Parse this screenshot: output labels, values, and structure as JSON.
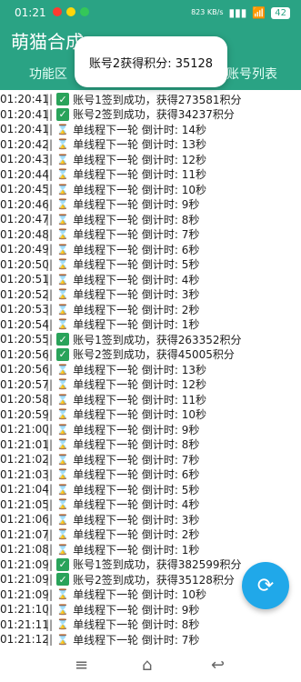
{
  "status_bar": {
    "time": "01:21",
    "indicators": [
      "network",
      "wifi"
    ],
    "battery": "42",
    "small_text": "823\nKB/s"
  },
  "header": {
    "title": "萌猫合成",
    "tabs": [
      "功能区",
      "账号列表"
    ]
  },
  "toast": {
    "text": "账号2获得积分: 35128"
  },
  "log": [
    {
      "time": "01:20:41",
      "type": "ok",
      "text": "账号1签到成功，获得273581积分"
    },
    {
      "time": "01:20:41",
      "type": "ok",
      "text": "账号2签到成功，获得34237积分"
    },
    {
      "time": "01:20:41",
      "type": "wait",
      "text": "单线程下一轮 倒计时: 14秒"
    },
    {
      "time": "01:20:42",
      "type": "wait",
      "text": "单线程下一轮 倒计时: 13秒"
    },
    {
      "time": "01:20:43",
      "type": "wait",
      "text": "单线程下一轮 倒计时: 12秒"
    },
    {
      "time": "01:20:44",
      "type": "wait",
      "text": "单线程下一轮 倒计时: 11秒"
    },
    {
      "time": "01:20:45",
      "type": "wait",
      "text": "单线程下一轮 倒计时: 10秒"
    },
    {
      "time": "01:20:46",
      "type": "wait",
      "text": "单线程下一轮 倒计时: 9秒"
    },
    {
      "time": "01:20:47",
      "type": "wait",
      "text": "单线程下一轮 倒计时: 8秒"
    },
    {
      "time": "01:20:48",
      "type": "wait",
      "text": "单线程下一轮 倒计时: 7秒"
    },
    {
      "time": "01:20:49",
      "type": "wait",
      "text": "单线程下一轮 倒计时: 6秒"
    },
    {
      "time": "01:20:50",
      "type": "wait",
      "text": "单线程下一轮 倒计时: 5秒"
    },
    {
      "time": "01:20:51",
      "type": "wait",
      "text": "单线程下一轮 倒计时: 4秒"
    },
    {
      "time": "01:20:52",
      "type": "wait",
      "text": "单线程下一轮 倒计时: 3秒"
    },
    {
      "time": "01:20:53",
      "type": "wait",
      "text": "单线程下一轮 倒计时: 2秒"
    },
    {
      "time": "01:20:54",
      "type": "wait",
      "text": "单线程下一轮 倒计时: 1秒"
    },
    {
      "time": "01:20:55",
      "type": "ok",
      "text": "账号1签到成功，获得263352积分"
    },
    {
      "time": "01:20:56",
      "type": "ok",
      "text": "账号2签到成功，获得45005积分"
    },
    {
      "time": "01:20:56",
      "type": "wait",
      "text": "单线程下一轮 倒计时: 13秒"
    },
    {
      "time": "01:20:57",
      "type": "wait",
      "text": "单线程下一轮 倒计时: 12秒"
    },
    {
      "time": "01:20:58",
      "type": "wait",
      "text": "单线程下一轮 倒计时: 11秒"
    },
    {
      "time": "01:20:59",
      "type": "wait",
      "text": "单线程下一轮 倒计时: 10秒"
    },
    {
      "time": "01:21:00",
      "type": "wait",
      "text": "单线程下一轮 倒计时: 9秒"
    },
    {
      "time": "01:21:01",
      "type": "wait",
      "text": "单线程下一轮 倒计时: 8秒"
    },
    {
      "time": "01:21:02",
      "type": "wait",
      "text": "单线程下一轮 倒计时: 7秒"
    },
    {
      "time": "01:21:03",
      "type": "wait",
      "text": "单线程下一轮 倒计时: 6秒"
    },
    {
      "time": "01:21:04",
      "type": "wait",
      "text": "单线程下一轮 倒计时: 5秒"
    },
    {
      "time": "01:21:05",
      "type": "wait",
      "text": "单线程下一轮 倒计时: 4秒"
    },
    {
      "time": "01:21:06",
      "type": "wait",
      "text": "单线程下一轮 倒计时: 3秒"
    },
    {
      "time": "01:21:07",
      "type": "wait",
      "text": "单线程下一轮 倒计时: 2秒"
    },
    {
      "time": "01:21:08",
      "type": "wait",
      "text": "单线程下一轮 倒计时: 1秒"
    },
    {
      "time": "01:21:09",
      "type": "ok",
      "text": "账号1签到成功，获得382599积分"
    },
    {
      "time": "01:21:09",
      "type": "ok",
      "text": "账号2签到成功，获得35128积分"
    },
    {
      "time": "01:21:09",
      "type": "wait",
      "text": "单线程下一轮 倒计时: 10秒"
    },
    {
      "time": "01:21:10",
      "type": "wait",
      "text": "单线程下一轮 倒计时: 9秒"
    },
    {
      "time": "01:21:11",
      "type": "wait",
      "text": "单线程下一轮 倒计时: 8秒"
    },
    {
      "time": "01:21:12",
      "type": "wait",
      "text": "单线程下一轮 倒计时: 7秒"
    }
  ],
  "fab": {
    "icon": "refresh-icon"
  },
  "nav": {
    "icons": [
      "menu-icon",
      "home-icon",
      "back-icon"
    ]
  },
  "colors": {
    "primary": "#2aa384",
    "fab": "#20a8e9",
    "success": "#29a35a",
    "hourglass": "#d28a00"
  }
}
